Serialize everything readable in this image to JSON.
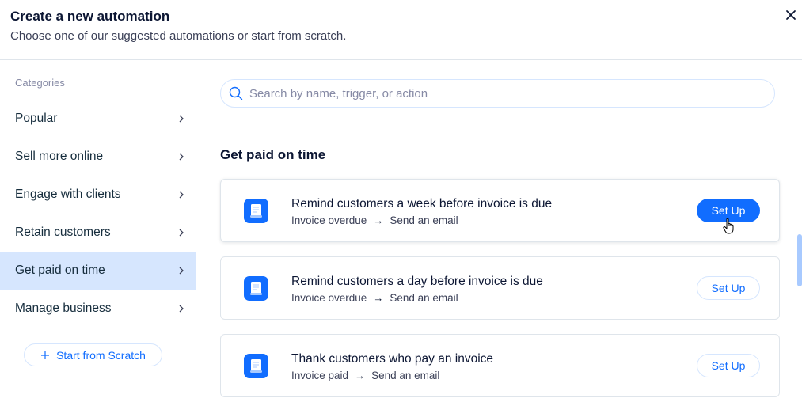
{
  "header": {
    "title": "Create a new automation",
    "subtitle": "Choose one of our suggested automations or start from scratch.",
    "close_icon": "close-icon"
  },
  "sidebar": {
    "label": "Categories",
    "items": [
      {
        "label": "Popular",
        "active": false
      },
      {
        "label": "Sell more online",
        "active": false
      },
      {
        "label": "Engage with clients",
        "active": false
      },
      {
        "label": "Retain customers",
        "active": false
      },
      {
        "label": "Get paid on time",
        "active": true
      },
      {
        "label": "Manage business",
        "active": false
      }
    ],
    "scratch_button": {
      "icon": "plus-icon",
      "label": "Start from Scratch"
    }
  },
  "main": {
    "search": {
      "placeholder": "Search by name, trigger, or action",
      "value": "",
      "icon": "search-icon"
    },
    "section_title": "Get paid on time",
    "cards": [
      {
        "title": "Remind customers a week before invoice is due",
        "trigger": "Invoice overdue",
        "action": "Send an email",
        "button": "Set Up",
        "icon": "invoice-icon"
      },
      {
        "title": "Remind customers a day before invoice is due",
        "trigger": "Invoice overdue",
        "action": "Send an email",
        "button": "Set Up",
        "icon": "invoice-icon"
      },
      {
        "title": "Thank customers who pay an invoice",
        "trigger": "Invoice paid",
        "action": "Send an email",
        "button": "Set Up",
        "icon": "invoice-icon"
      }
    ],
    "arrow": "→"
  },
  "colors": {
    "accent": "#116dff",
    "active_bg": "#d6e6fe",
    "text": "#0c1633",
    "muted": "#868aa5",
    "scrollbar": "#a8caff"
  }
}
